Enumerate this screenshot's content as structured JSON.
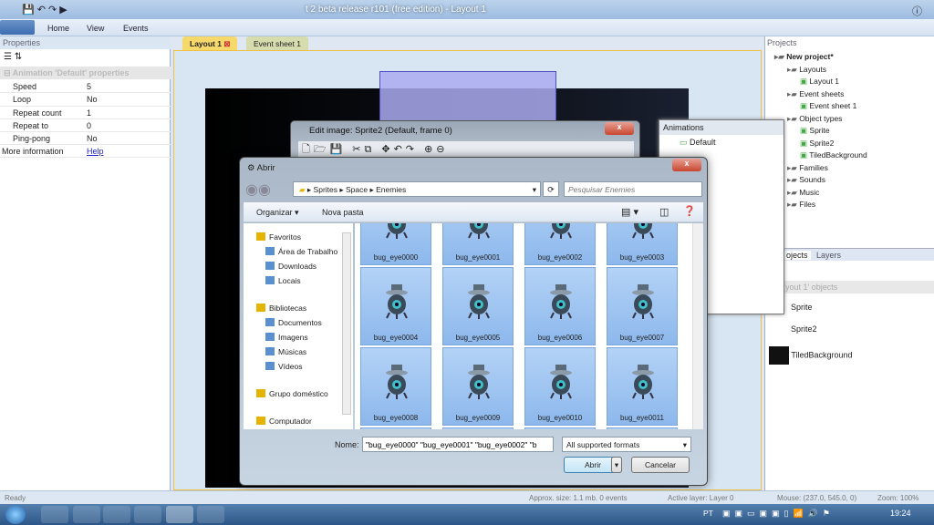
{
  "window": {
    "title": "t 2 beta release r101 (free edition) - Layout 1"
  },
  "ribbon": {
    "tabs": [
      "Home",
      "View",
      "Events"
    ]
  },
  "properties": {
    "title": "Properties",
    "section": "Animation 'Default' properties",
    "rows": [
      {
        "k": "Speed",
        "v": "5"
      },
      {
        "k": "Loop",
        "v": "No"
      },
      {
        "k": "Repeat count",
        "v": "1"
      },
      {
        "k": "Repeat to",
        "v": "0"
      },
      {
        "k": "Ping-pong",
        "v": "No"
      }
    ],
    "more_label": "More information",
    "help_link": "Help"
  },
  "doc_tabs": [
    "Layout 1",
    "Event sheet 1"
  ],
  "projects": {
    "title": "Projects",
    "tree": [
      {
        "label": "New project*",
        "lvl": 0
      },
      {
        "label": "Layouts",
        "lvl": 1
      },
      {
        "label": "Layout 1",
        "lvl": 2
      },
      {
        "label": "Event sheets",
        "lvl": 1
      },
      {
        "label": "Event sheet 1",
        "lvl": 2
      },
      {
        "label": "Object types",
        "lvl": 1
      },
      {
        "label": "Sprite",
        "lvl": 2
      },
      {
        "label": "Sprite2",
        "lvl": 2
      },
      {
        "label": "TiledBackground",
        "lvl": 2
      },
      {
        "label": "Families",
        "lvl": 1
      },
      {
        "label": "Sounds",
        "lvl": 1
      },
      {
        "label": "Music",
        "lvl": 1
      },
      {
        "label": "Files",
        "lvl": 1
      }
    ],
    "tabs": [
      "ojects",
      "Layers"
    ]
  },
  "objects": {
    "header": "yout 1' objects",
    "items": [
      "Sprite",
      "Sprite2",
      "TiledBackground"
    ]
  },
  "edit_image": {
    "title": "Edit image: Sprite2 (Default, frame 0)"
  },
  "animations": {
    "title": "Animations",
    "items": [
      "Default"
    ]
  },
  "abrir": {
    "title": "Abrir",
    "breadcrumb": [
      "Sprites",
      "Space",
      "Enemies"
    ],
    "search_placeholder": "Pesquisar Enemies",
    "organize": "Organizar ▾",
    "new_folder": "Nova pasta",
    "nav": [
      {
        "label": "Favoritos",
        "group": true
      },
      {
        "label": "Área de Trabalho"
      },
      {
        "label": "Downloads"
      },
      {
        "label": "Locais"
      },
      {
        "label": "Bibliotecas",
        "group": true
      },
      {
        "label": "Documentos"
      },
      {
        "label": "Imagens"
      },
      {
        "label": "Músicas"
      },
      {
        "label": "Vídeos"
      },
      {
        "label": "Grupo doméstico",
        "group": true
      },
      {
        "label": "Computador",
        "group": true
      }
    ],
    "files": [
      "bug_eye0000",
      "bug_eye0001",
      "bug_eye0002",
      "bug_eye0003",
      "bug_eye0004",
      "bug_eye0005",
      "bug_eye0006",
      "bug_eye0007",
      "bug_eye0008",
      "bug_eye0009",
      "bug_eye0010",
      "bug_eye0011"
    ],
    "name_label": "Nome:",
    "name_value": "\"bug_eye0000\" \"bug_eye0001\" \"bug_eye0002\" \"b",
    "filter": "All supported formats",
    "open": "Abrir",
    "cancel": "Cancelar"
  },
  "status": {
    "ready": "Ready",
    "size": "Approx. size: 1.1 mb. 0 events",
    "layer": "Active layer: Layer 0",
    "mouse": "Mouse: (237.0, 545.0, 0)",
    "zoom": "Zoom: 100%"
  },
  "taskbar": {
    "lang": "PT",
    "clock": "19:24"
  }
}
